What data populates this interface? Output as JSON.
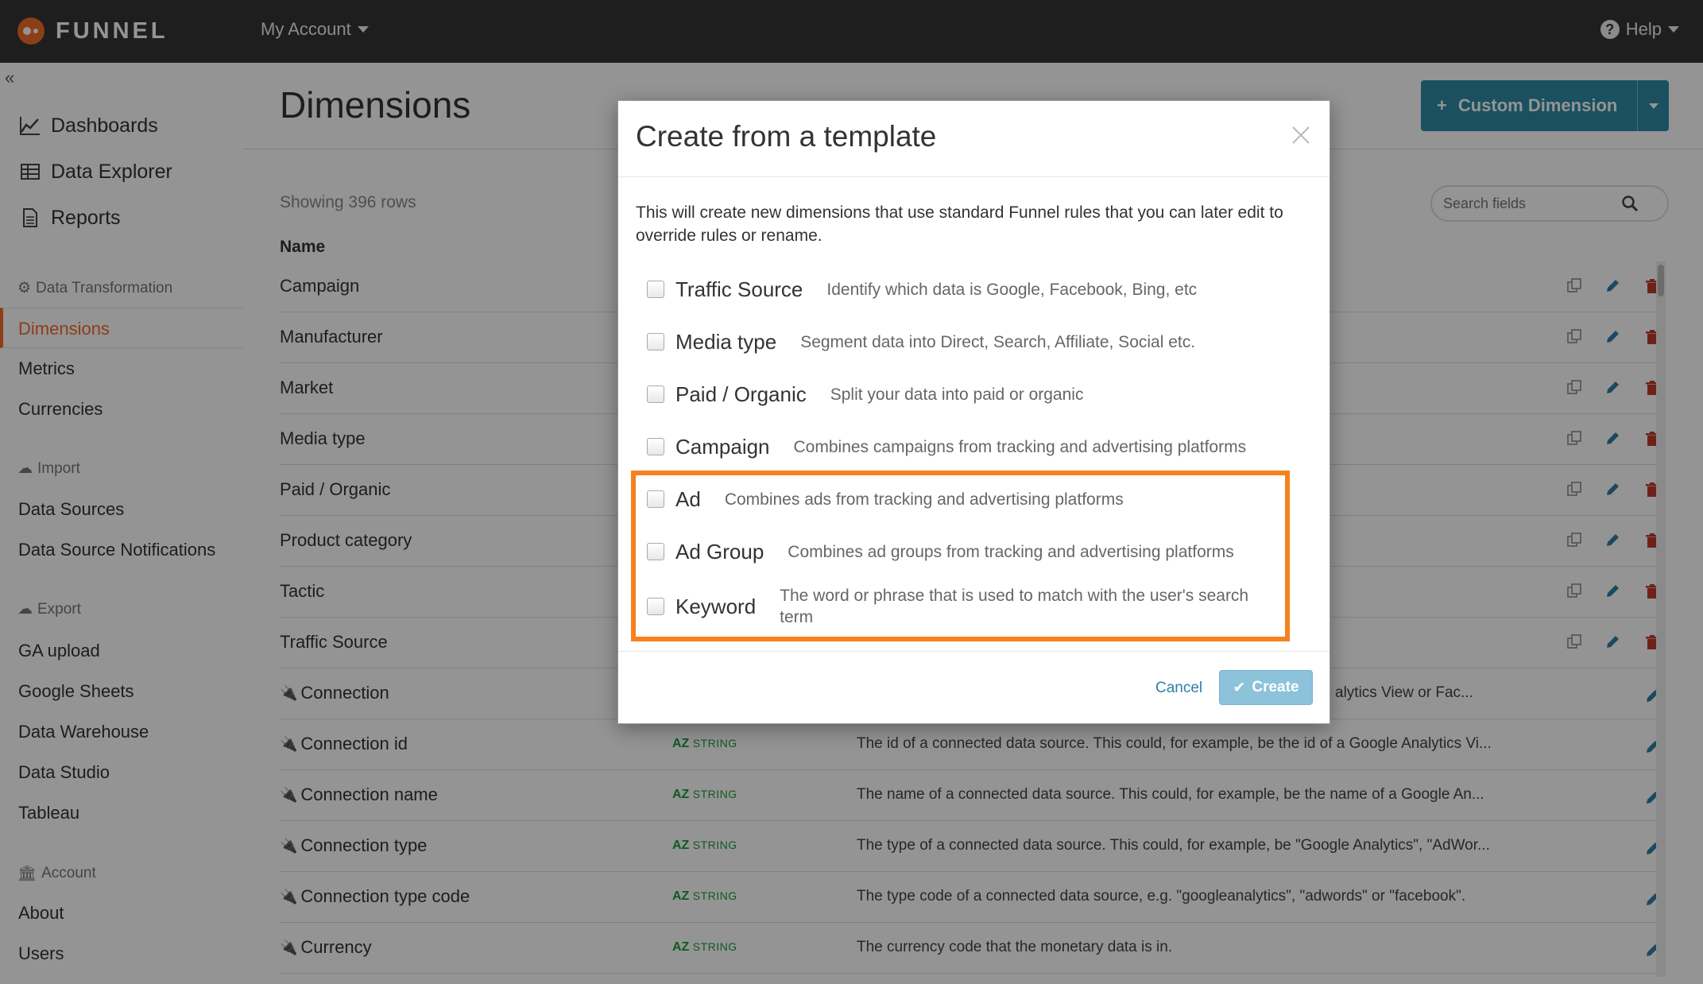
{
  "topbar": {
    "brand": "FUNNEL",
    "account_menu": "My Account",
    "help_menu": "Help",
    "help_icon": "?"
  },
  "sidebar": {
    "collapse_icon": "«",
    "main_items": [
      {
        "label": "Dashboards",
        "icon": "line-chart-icon"
      },
      {
        "label": "Data Explorer",
        "icon": "table-icon"
      },
      {
        "label": "Reports",
        "icon": "document-icon"
      }
    ],
    "groups": {
      "transformation": {
        "title": "Data Transformation",
        "icon": "gear-icon",
        "items": [
          "Dimensions",
          "Metrics",
          "Currencies"
        ]
      },
      "import": {
        "title": "Import",
        "icon": "cloud-upload-icon",
        "items": [
          "Data Sources",
          "Data Source Notifications"
        ]
      },
      "export": {
        "title": "Export",
        "icon": "cloud-download-icon",
        "items": [
          "GA upload",
          "Google Sheets",
          "Data Warehouse",
          "Data Studio",
          "Tableau"
        ]
      },
      "account": {
        "title": "Account",
        "icon": "bank-icon",
        "items": [
          "About",
          "Users"
        ]
      }
    },
    "active_item": "Dimensions"
  },
  "page": {
    "title": "Dimensions",
    "custom_dimension_button": "Custom Dimension",
    "showing": "Showing 396 rows",
    "search_placeholder": "Search fields",
    "column_name": "Name",
    "rows": [
      {
        "name": "Campaign",
        "type_prefix": "",
        "type": "",
        "desc": ""
      },
      {
        "name": "Manufacturer",
        "type_prefix": "",
        "type": "",
        "desc": ""
      },
      {
        "name": "Market",
        "type_prefix": "",
        "type": "",
        "desc": ""
      },
      {
        "name": "Media type",
        "type_prefix": "",
        "type": "",
        "desc": ""
      },
      {
        "name": "Paid / Organic",
        "type_prefix": "",
        "type": "",
        "desc": ""
      },
      {
        "name": "Product category",
        "type_prefix": "",
        "type": "",
        "desc": ""
      },
      {
        "name": "Tactic",
        "type_prefix": "",
        "type": "",
        "desc": ""
      },
      {
        "name": "Traffic Source",
        "type_prefix": "",
        "type": "",
        "desc": ""
      },
      {
        "name": "Connection",
        "type_prefix": "",
        "type": "",
        "desc": "alytics View or Fac..."
      },
      {
        "name": "Connection id",
        "type_prefix": "AZ",
        "type": "STRING",
        "desc": "The id of a connected data source. This could, for example, be the id of a Google Analytics Vi..."
      },
      {
        "name": "Connection name",
        "type_prefix": "AZ",
        "type": "STRING",
        "desc": "The name of a connected data source. This could, for example, be the name of a Google An..."
      },
      {
        "name": "Connection type",
        "type_prefix": "AZ",
        "type": "STRING",
        "desc": "The type of a connected data source. This could, for example, be \"Google Analytics\", \"AdWor..."
      },
      {
        "name": "Connection type code",
        "type_prefix": "AZ",
        "type": "STRING",
        "desc": "The type code of a connected data source, e.g. \"googleanalytics\", \"adwords\" or \"facebook\"."
      },
      {
        "name": "Currency",
        "type_prefix": "AZ",
        "type": "STRING",
        "desc": "The currency code that the monetary data is in."
      }
    ]
  },
  "modal": {
    "title": "Create from a template",
    "intro": "This will create new dimensions that use standard Funnel rules that you can later edit to override rules or rename.",
    "options": [
      {
        "label": "Traffic Source",
        "desc": "Identify which data is Google, Facebook, Bing, etc"
      },
      {
        "label": "Media type",
        "desc": "Segment data into Direct, Search, Affiliate, Social etc."
      },
      {
        "label": "Paid / Organic",
        "desc": "Split your data into paid or organic"
      },
      {
        "label": "Campaign",
        "desc": "Combines campaigns from tracking and advertising platforms"
      },
      {
        "label": "Ad",
        "desc": "Combines ads from tracking and advertising platforms"
      },
      {
        "label": "Ad Group",
        "desc": "Combines ad groups from tracking and advertising platforms"
      },
      {
        "label": "Keyword",
        "desc": "The word or phrase that is used to match with the user's search term"
      }
    ],
    "cancel": "Cancel",
    "create": "Create",
    "highlight_color": "#f7811f"
  }
}
